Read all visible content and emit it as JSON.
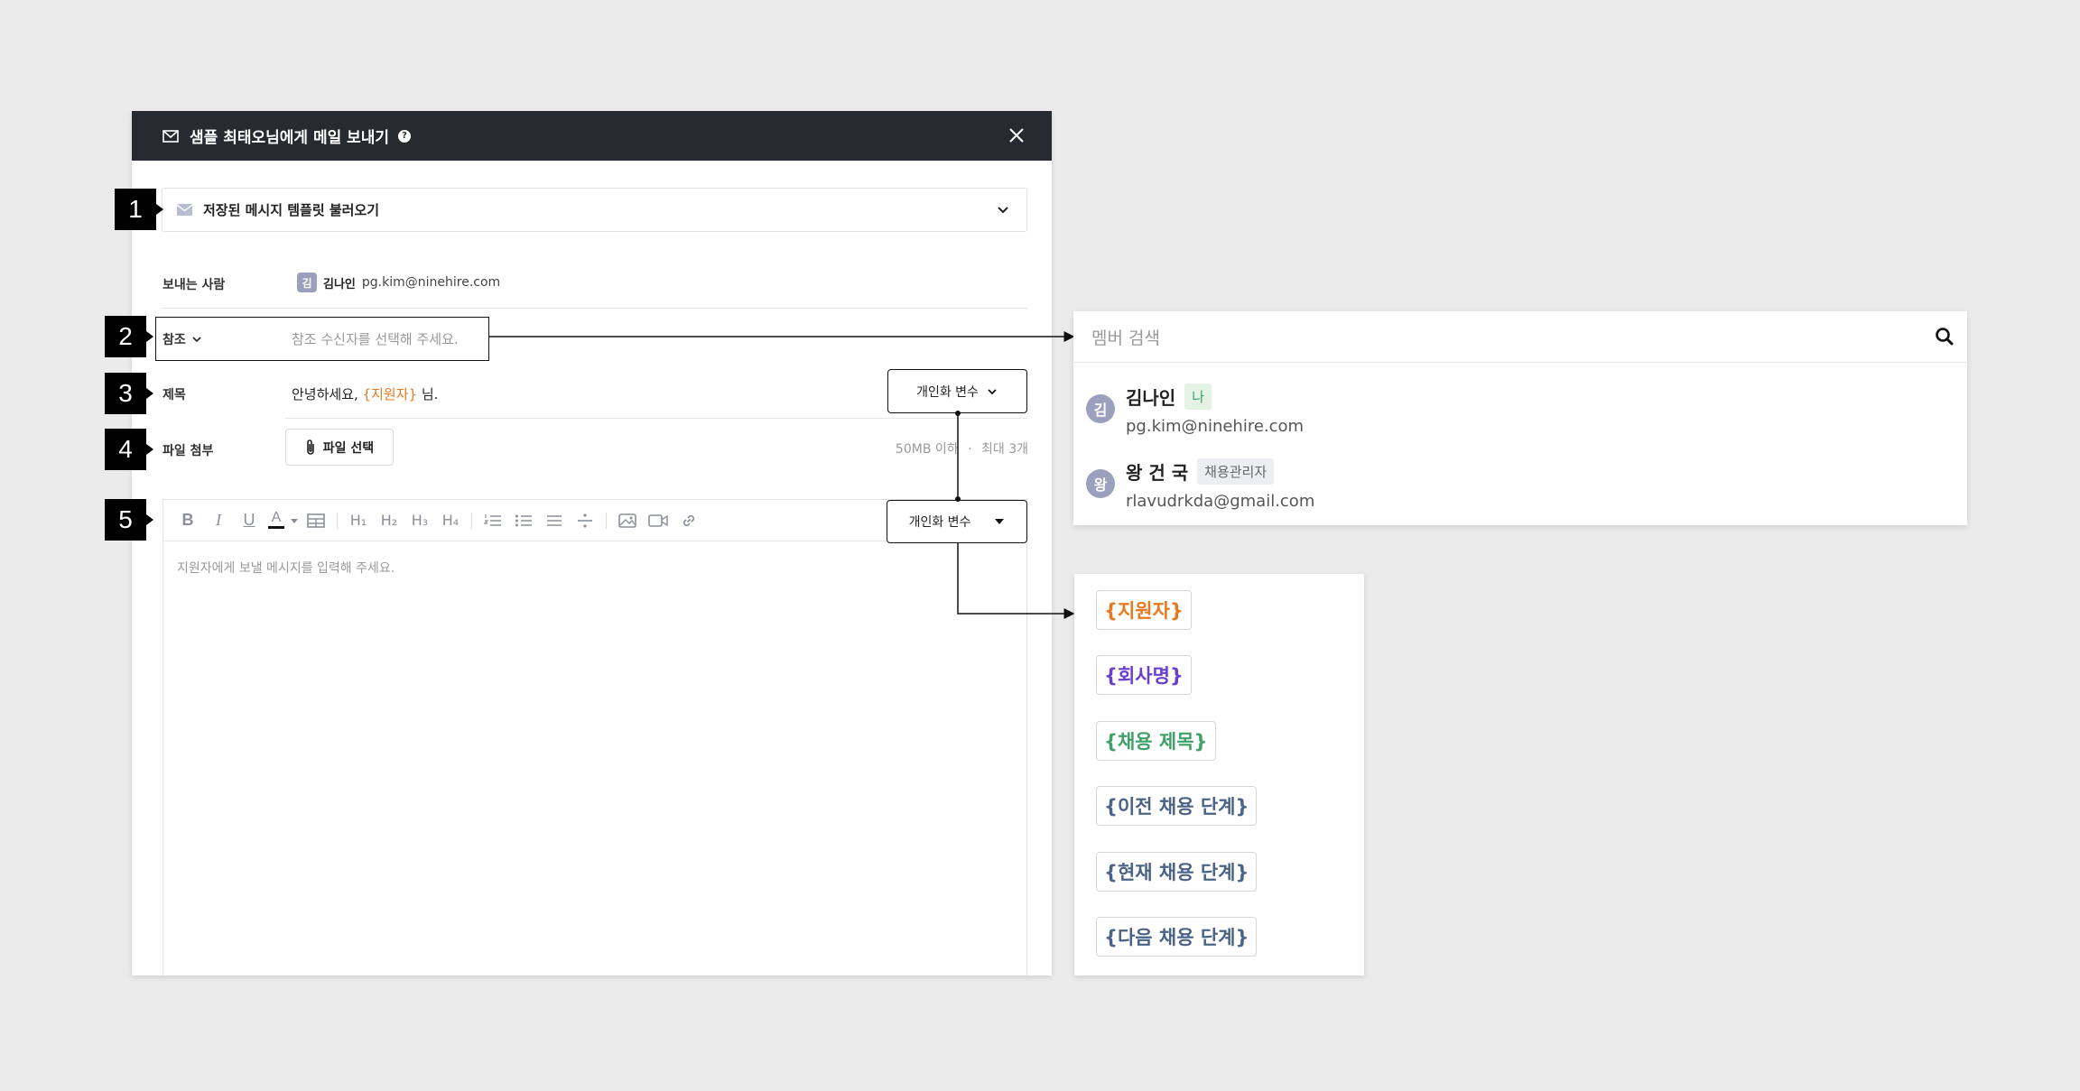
{
  "modal": {
    "title": "샘플 최태오님에게 메일 보내기",
    "help_icon": "?",
    "template_select_label": "저장된 메시지 템플릿 불러오기",
    "sender": {
      "label": "보내는 사람",
      "avatar": "김",
      "name": "김나인",
      "email": "pg.kim@ninehire.com"
    },
    "cc": {
      "label": "참조",
      "placeholder": "참조 수신자를 선택해 주세요."
    },
    "subject": {
      "label": "제목",
      "prefix": "안녕하세요, ",
      "variable": "{지원자}",
      "suffix": " 님.",
      "variable_button": "개인화 변수"
    },
    "attachment": {
      "label": "파일 첨부",
      "button": "파일 선택",
      "size_limit": "50MB 이하",
      "separator": "·",
      "count_limit": "최대 3개"
    },
    "editor": {
      "toolbar": [
        "bold-icon",
        "italic-icon",
        "underline-icon",
        "text-color-icon",
        "table-icon",
        "heading1-icon",
        "heading2-icon",
        "heading3-icon",
        "heading4-icon",
        "ordered-list-icon",
        "bullet-list-icon",
        "align-icon",
        "divider-icon",
        "image-icon",
        "video-icon",
        "link-icon"
      ],
      "h1": "H₁",
      "h2": "H₂",
      "h3": "H₃",
      "h4": "H₄",
      "variable_button": "개인화 변수",
      "placeholder": "지원자에게 보낼 메시지를 입력해 주세요."
    }
  },
  "markers": [
    "1",
    "2",
    "3",
    "4",
    "5"
  ],
  "member_panel": {
    "search_placeholder": "멤버 검색",
    "members": [
      {
        "avatar": "김",
        "name": "김나인",
        "badge": "나",
        "email": "pg.kim@ninehire.com"
      },
      {
        "avatar": "왕",
        "name": "왕 건 국",
        "badge": "채용관리자",
        "email": "rlavudrkda@gmail.com"
      }
    ]
  },
  "variables_panel": {
    "items": [
      {
        "label": "{지원자}",
        "color": "#e8781e"
      },
      {
        "label": "{회사명}",
        "color": "#6a3fd0"
      },
      {
        "label": "{채용 제목}",
        "color": "#3fa068"
      },
      {
        "label": "{이전 채용 단계}",
        "color": "#4a6387"
      },
      {
        "label": "{현재 채용 단계}",
        "color": "#4a6387"
      },
      {
        "label": "{다음 채용 단계}",
        "color": "#4a6387"
      }
    ]
  },
  "colors": {
    "header_bg": "#272a31",
    "variable_orange": "#e8781e",
    "badge_me_bg": "#e4f3e4",
    "badge_me_text": "#3fa068",
    "badge_role_bg": "#eceef1",
    "badge_role_text": "#666666"
  }
}
